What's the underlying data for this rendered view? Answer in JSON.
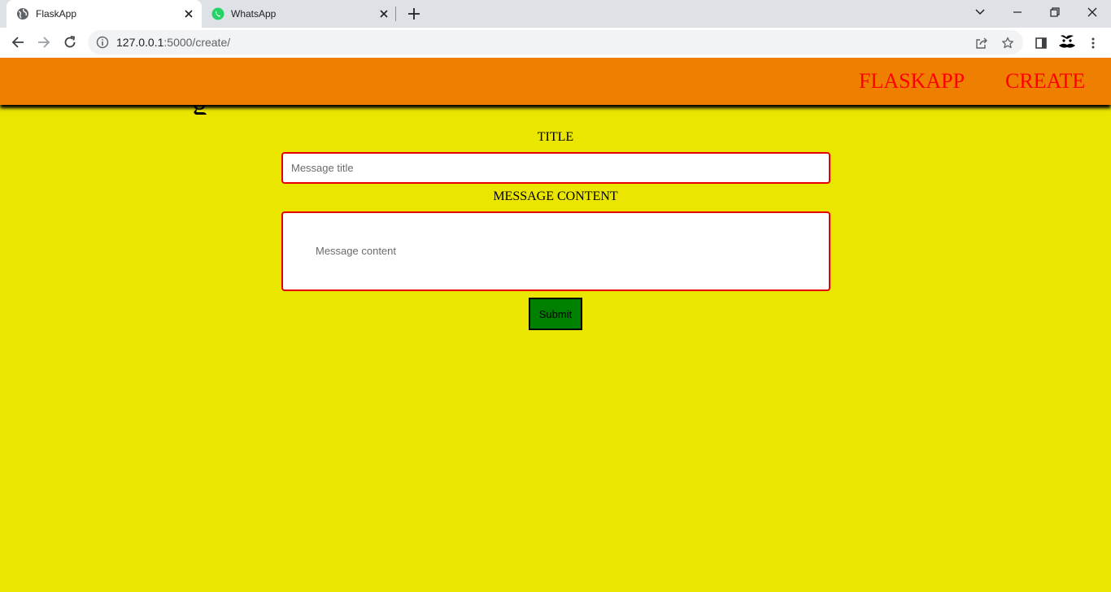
{
  "browser": {
    "tabs": [
      {
        "title": "FlaskApp",
        "icon": "globe-icon",
        "active": true
      },
      {
        "title": "WhatsApp",
        "icon": "whatsapp-icon",
        "active": false
      }
    ],
    "url_host": "127.0.0.1",
    "url_path": ":5000/create/"
  },
  "navbar": {
    "brand": "FLASKAPP",
    "create_link": "CREATE"
  },
  "hidden_heading": "g",
  "form": {
    "title_label": "TITLE",
    "title_placeholder": "Message title",
    "content_label": "MESSAGE CONTENT",
    "content_placeholder": "Message content",
    "submit_label": "Submit"
  },
  "colors": {
    "page_background": "#eae600",
    "navbar": "#ef7f00",
    "nav_links": "#ff0000",
    "field_border": "#e60000",
    "submit_button": "#008000"
  }
}
